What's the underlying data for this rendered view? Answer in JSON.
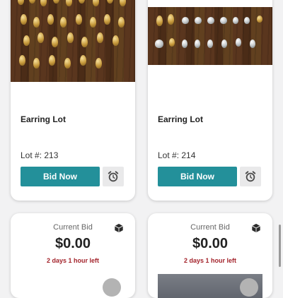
{
  "colors": {
    "bid_button": "#23909a",
    "time_left_text": "#a3232b",
    "alarm_button_bg": "#e9e9ea"
  },
  "lots": [
    {
      "title": "Earring Lot",
      "lot_label": "Lot #: 213",
      "bid_button_label": "Bid Now",
      "image": "gold-earrings-on-wood-photo",
      "alarm_icon": "alarm-clock-icon"
    },
    {
      "title": "Earring Lot",
      "lot_label": "Lot #: 214",
      "bid_button_label": "Bid Now",
      "image": "silver-and-gold-earrings-photo",
      "alarm_icon": "alarm-clock-icon"
    },
    {
      "current_bid_label": "Current Bid",
      "current_bid_amount": "$0.00",
      "time_left": "2 days 1 hour left",
      "icon": "cube-icon"
    },
    {
      "current_bid_label": "Current Bid",
      "current_bid_amount": "$0.00",
      "time_left": "2 days 1 hour left",
      "icon": "cube-icon"
    }
  ]
}
